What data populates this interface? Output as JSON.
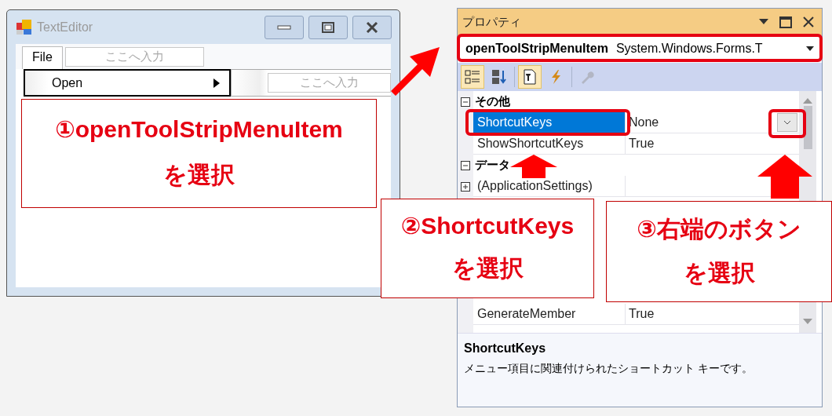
{
  "designer_window": {
    "title": "TextEditor",
    "menu": [
      {
        "label": "File",
        "selected": true
      }
    ],
    "menu_placeholder": "ここへ入力",
    "dropdown_items": [
      {
        "label": "Open",
        "selected": true,
        "has_submenu": true
      }
    ],
    "submenu_placeholder": "ここへ入力"
  },
  "properties_panel": {
    "title": "プロパティ",
    "object_name": "openToolStripMenuItem",
    "object_type": "System.Windows.Forms.T",
    "toolbar": [
      {
        "kind": "categorized",
        "selected": true,
        "disabled": false
      },
      {
        "kind": "alphabetical",
        "selected": false,
        "disabled": false
      },
      {
        "kind": "properties",
        "selected": true,
        "disabled": false
      },
      {
        "kind": "events",
        "selected": false,
        "disabled": false
      },
      {
        "kind": "property-pages",
        "selected": false,
        "disabled": true
      }
    ],
    "categories": [
      {
        "name": "その他",
        "expanded": true,
        "rows": [
          {
            "name": "ShortcutKeys",
            "value": "None",
            "selected": true,
            "has_dropdown": true
          },
          {
            "name": "ShowShortcutKeys",
            "value": "True",
            "selected": false,
            "has_dropdown": false
          }
        ]
      },
      {
        "name": "データ",
        "expanded": true,
        "rows": [
          {
            "name": "(ApplicationSettings)",
            "selected": false,
            "expandable": true,
            "expanded": false
          }
        ]
      }
    ],
    "lower_rows": [
      {
        "name": "GenerateMember",
        "value": "True",
        "selected": false
      }
    ],
    "description": {
      "title": "ShortcutKeys",
      "text": "メニュー項目に関連付けられたショートカット キーです。"
    }
  },
  "callouts": [
    {
      "lines": [
        "①openToolStripMenuItem",
        "を選択"
      ]
    },
    {
      "lines": [
        "②ShortcutKeys",
        "を選択"
      ]
    },
    {
      "lines": [
        "③右端のボタン",
        "を選択"
      ]
    }
  ]
}
